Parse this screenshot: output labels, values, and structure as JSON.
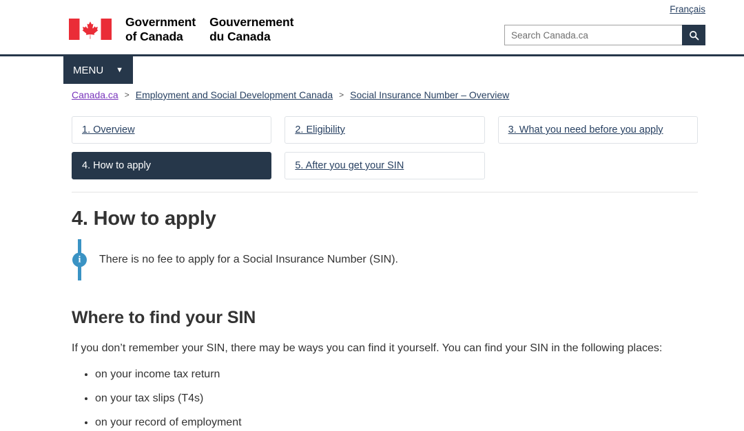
{
  "header": {
    "flag_alt": "canada-flag",
    "wordmark_en_line1": "Government",
    "wordmark_en_line2": "of Canada",
    "wordmark_fr_line1": "Gouvernement",
    "wordmark_fr_line2": "du Canada",
    "language_toggle": "Français",
    "search_placeholder": "Search Canada.ca",
    "search_value": "",
    "search_button_label": "Search"
  },
  "menu": {
    "label": "MENU",
    "caret": "⌄"
  },
  "breadcrumb": {
    "separator": ">",
    "items": [
      {
        "label": "Canada.ca",
        "visited": true
      },
      {
        "label": "Employment and Social Development Canada",
        "visited": false
      },
      {
        "label": "Social Insurance Number – Overview",
        "visited": false
      }
    ]
  },
  "section_nav": [
    {
      "label": "1. Overview",
      "active": false
    },
    {
      "label": "2. Eligibility",
      "active": false
    },
    {
      "label": "3. What you need before you apply",
      "active": false
    },
    {
      "label": "4. How to apply",
      "active": true
    },
    {
      "label": "5. After you get your SIN",
      "active": false
    }
  ],
  "main": {
    "page_title": "4. How to apply",
    "callout": {
      "icon": "info-icon",
      "text": "There is no fee to apply for a Social Insurance Number (SIN)."
    },
    "section_title": "Where to find your SIN",
    "intro_paragraph": "If you don’t remember your SIN, there may be ways you can find it yourself. You can find your SIN in the following places:",
    "bullets": [
      "on your income tax return",
      "on your tax slips (T4s)",
      "on your record of employment"
    ]
  },
  "colors": {
    "navy": "#26374a",
    "link_blue": "#284162",
    "visited_purple": "#7834bc",
    "flag_red": "#ea2d37",
    "info_teal": "#3a93c4",
    "border_gray": "#dee2e6"
  }
}
